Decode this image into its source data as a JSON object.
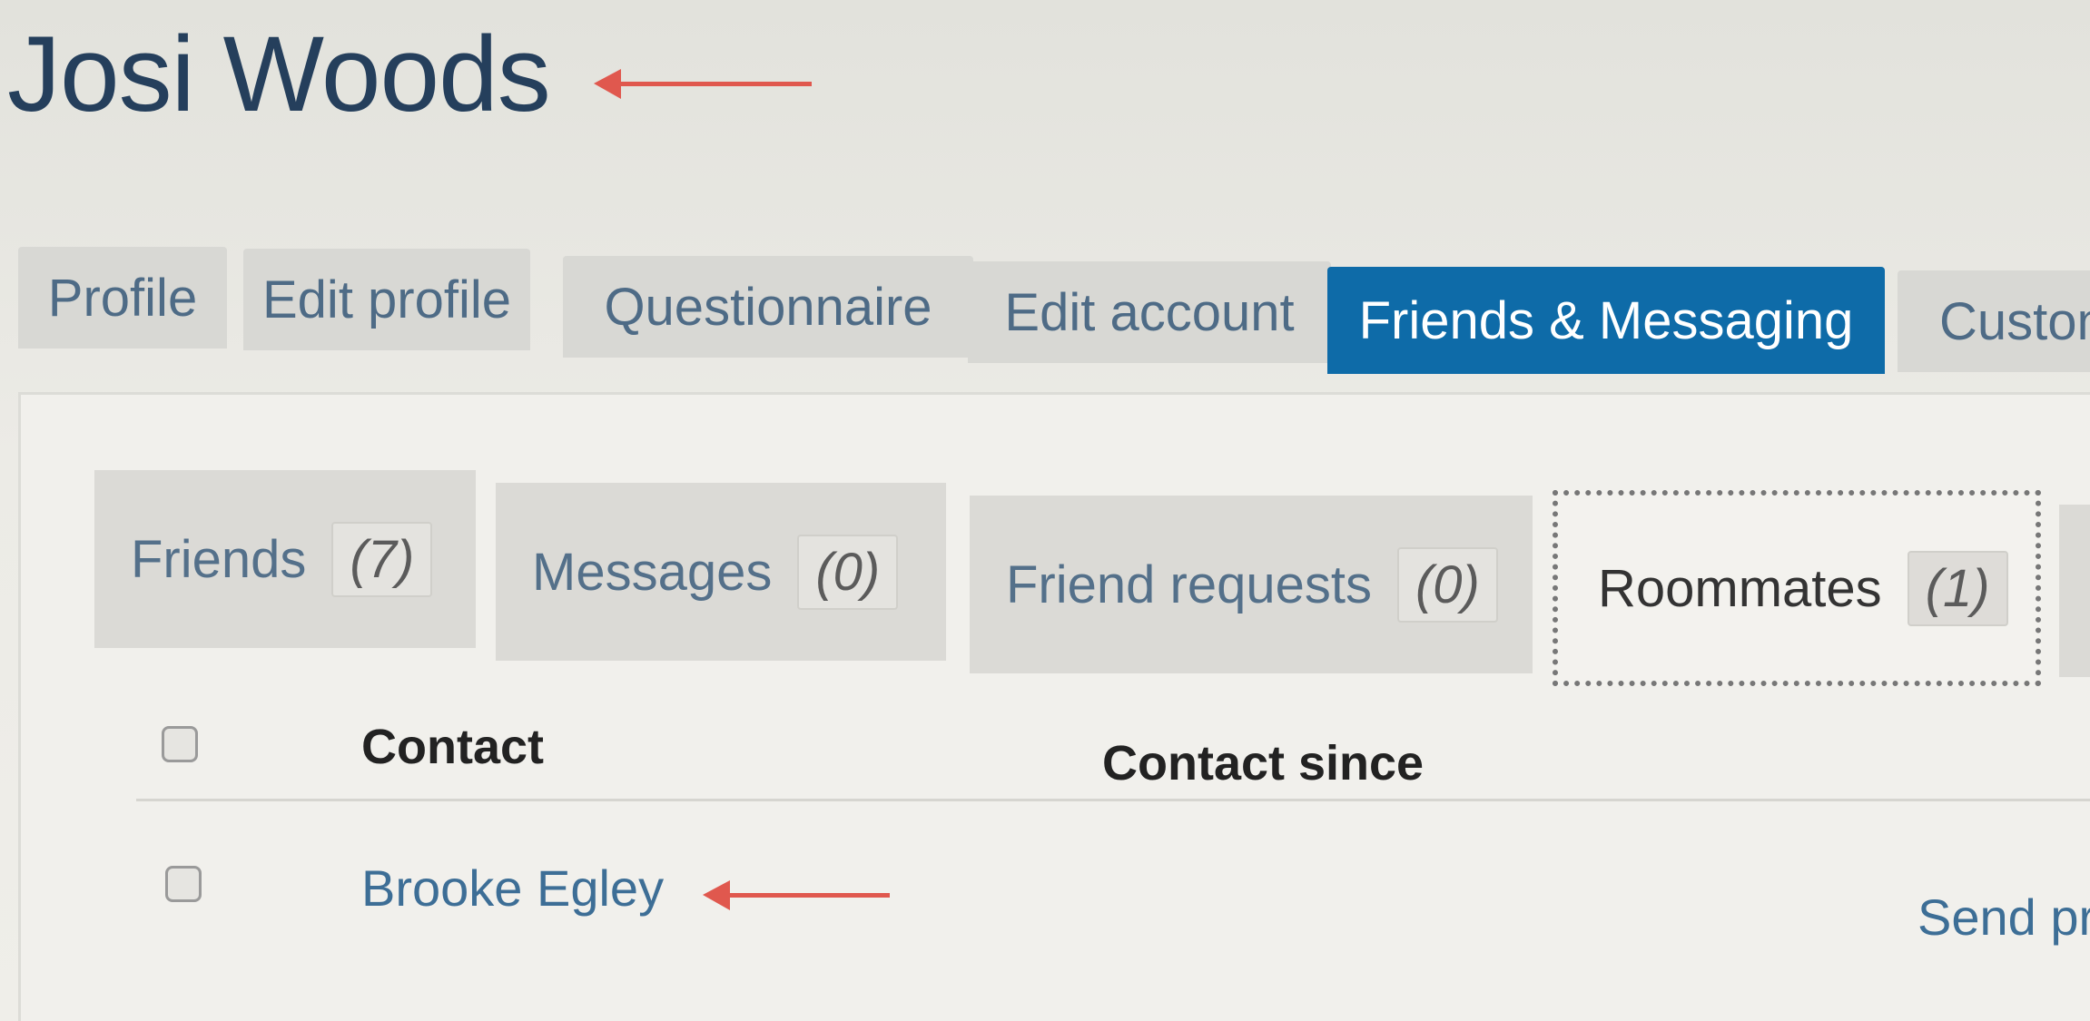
{
  "page_title": "Josi Woods",
  "main_tabs": [
    {
      "label": "Profile"
    },
    {
      "label": "Edit profile"
    },
    {
      "label": "Questionnaire"
    },
    {
      "label": "Edit account"
    },
    {
      "label": "Friends & Messaging",
      "active": true
    },
    {
      "label": "Custom"
    }
  ],
  "sub_tabs": [
    {
      "label": "Friends",
      "count": "(7)"
    },
    {
      "label": "Messages",
      "count": "(0)"
    },
    {
      "label": "Friend requests",
      "count": "(0)"
    },
    {
      "label": "Roommates",
      "count": "(1)",
      "active": true
    }
  ],
  "table": {
    "headers": [
      "Contact",
      "Contact since"
    ],
    "rows": [
      {
        "contact": "Brooke Egley",
        "action": "Send pr"
      }
    ]
  },
  "colors": {
    "active_tab": "#0e6ba8",
    "annotation_arrow": "#e0584e",
    "link": "#3d6e96"
  }
}
